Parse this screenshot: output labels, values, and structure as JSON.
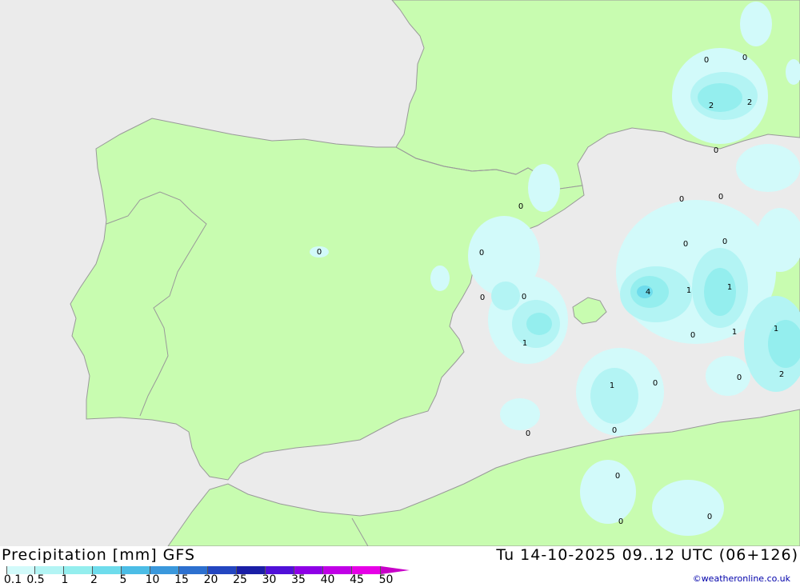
{
  "header": {
    "product": "Precipitation [mm] GFS",
    "valid_time": "Tu 14-10-2025 09..12 UTC (06+126)"
  },
  "legend": {
    "ticks": [
      "0.1",
      "0.5",
      "1",
      "2",
      "5",
      "10",
      "15",
      "20",
      "25",
      "30",
      "35",
      "40",
      "45",
      "50"
    ],
    "colors": [
      "#d2fafa",
      "#b3f4f4",
      "#94eeee",
      "#6edcec",
      "#4cbde6",
      "#3a98dc",
      "#2d70cf",
      "#2346c0",
      "#1a1ea6",
      "#5010d8",
      "#8e00e6",
      "#c000e6",
      "#e600e6",
      "#c800c8"
    ]
  },
  "credit": "©weatheronline.co.uk",
  "map": {
    "colors": {
      "sea": "#ebebeb",
      "land": "#c8fcb0",
      "border": "#999999"
    },
    "value_labels": [
      "0",
      "0",
      "2",
      "2",
      "0",
      "0",
      "0",
      "0",
      "0",
      "0",
      "0",
      "0",
      "4",
      "1",
      "1",
      "0",
      "1",
      "1",
      "1",
      "0",
      "2",
      "1",
      "0",
      "0",
      "0",
      "0",
      "0",
      "0",
      "0"
    ]
  }
}
